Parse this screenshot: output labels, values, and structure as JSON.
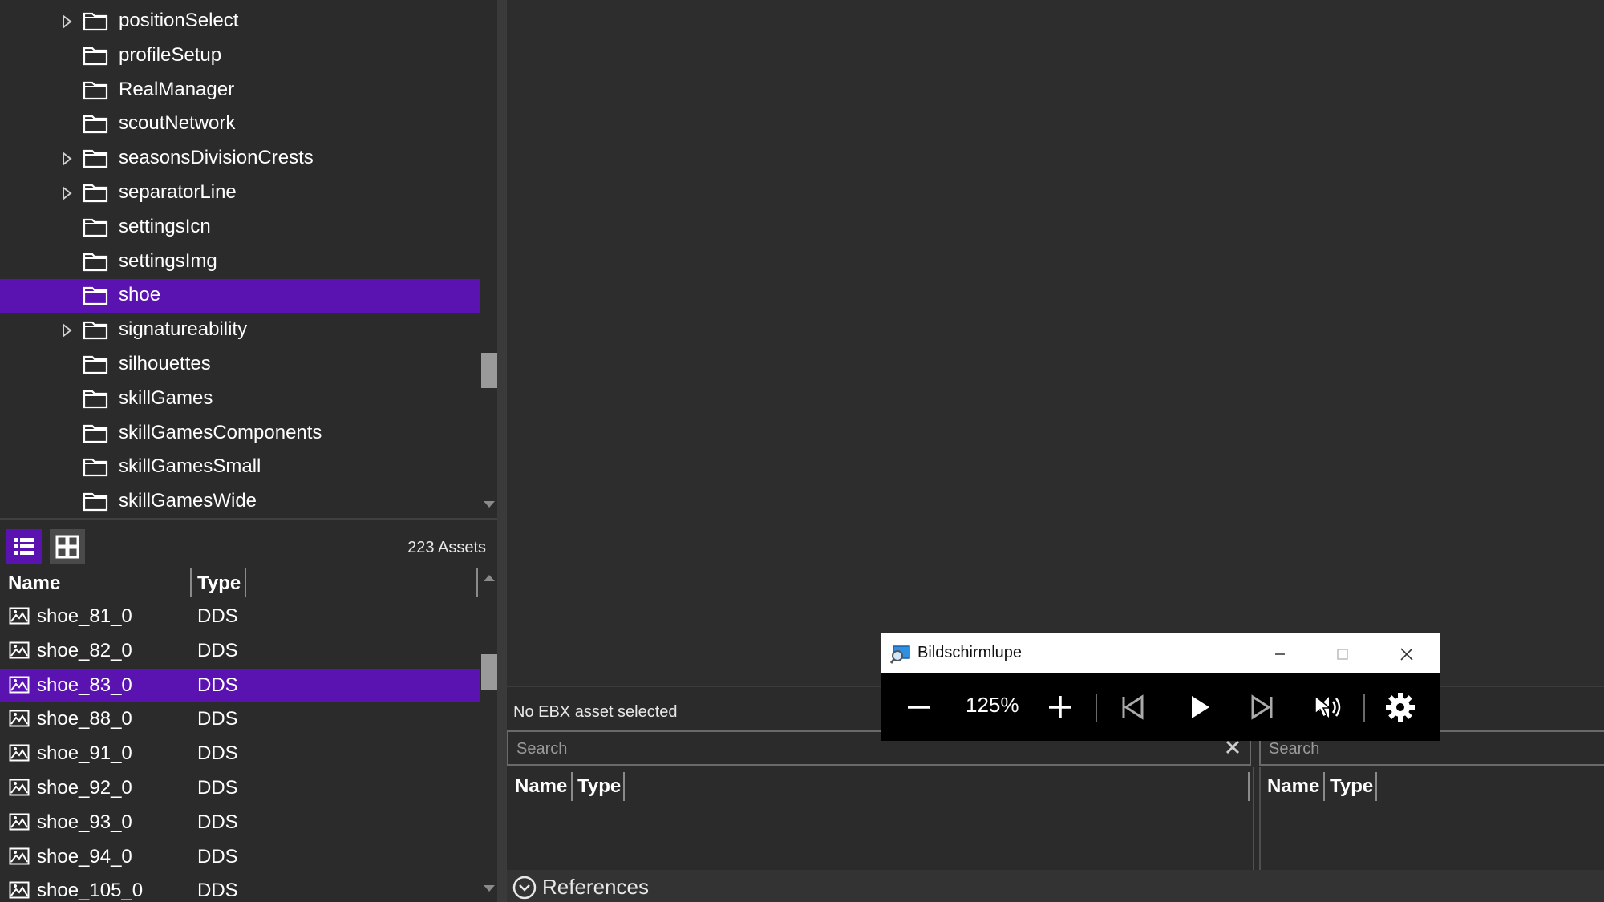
{
  "tree": {
    "items": [
      {
        "label": "positionSelect",
        "expandable": true
      },
      {
        "label": "profileSetup",
        "expandable": false
      },
      {
        "label": "RealManager",
        "expandable": false
      },
      {
        "label": "scoutNetwork",
        "expandable": false
      },
      {
        "label": "seasonsDivisionCrests",
        "expandable": true
      },
      {
        "label": "separatorLine",
        "expandable": true
      },
      {
        "label": "settingsIcn",
        "expandable": false
      },
      {
        "label": "settingsImg",
        "expandable": false
      },
      {
        "label": "shoe",
        "expandable": false,
        "selected": true
      },
      {
        "label": "signatureability",
        "expandable": true
      },
      {
        "label": "silhouettes",
        "expandable": false
      },
      {
        "label": "skillGames",
        "expandable": false
      },
      {
        "label": "skillGamesComponents",
        "expandable": false
      },
      {
        "label": "skillGamesSmall",
        "expandable": false
      },
      {
        "label": "skillGamesWide",
        "expandable": false
      }
    ]
  },
  "asset_toolbar": {
    "count_label": "223 Assets",
    "list_view_icon": "list-view-icon",
    "grid_view_icon": "grid-view-icon"
  },
  "asset_list": {
    "columns": [
      "Name",
      "Type"
    ],
    "rows": [
      {
        "name": "shoe_81_0",
        "type": "DDS"
      },
      {
        "name": "shoe_82_0",
        "type": "DDS"
      },
      {
        "name": "shoe_83_0",
        "type": "DDS",
        "selected": true
      },
      {
        "name": "shoe_88_0",
        "type": "DDS"
      },
      {
        "name": "shoe_91_0",
        "type": "DDS"
      },
      {
        "name": "shoe_92_0",
        "type": "DDS"
      },
      {
        "name": "shoe_93_0",
        "type": "DDS"
      },
      {
        "name": "shoe_94_0",
        "type": "DDS"
      },
      {
        "name": "shoe_105_0",
        "type": "DDS"
      }
    ]
  },
  "bottom_panel": {
    "status": "No EBX asset selected",
    "left_search": {
      "placeholder": "Search"
    },
    "right_search": {
      "placeholder": "Search"
    },
    "left_columns": [
      "Name",
      "Type"
    ],
    "right_columns": [
      "Name",
      "Type"
    ],
    "references_label": "References"
  },
  "magnifier": {
    "title": "Bildschirmlupe",
    "zoom": "125%"
  },
  "colors": {
    "accent": "#5a12b0",
    "background": "#2b2b2b"
  }
}
